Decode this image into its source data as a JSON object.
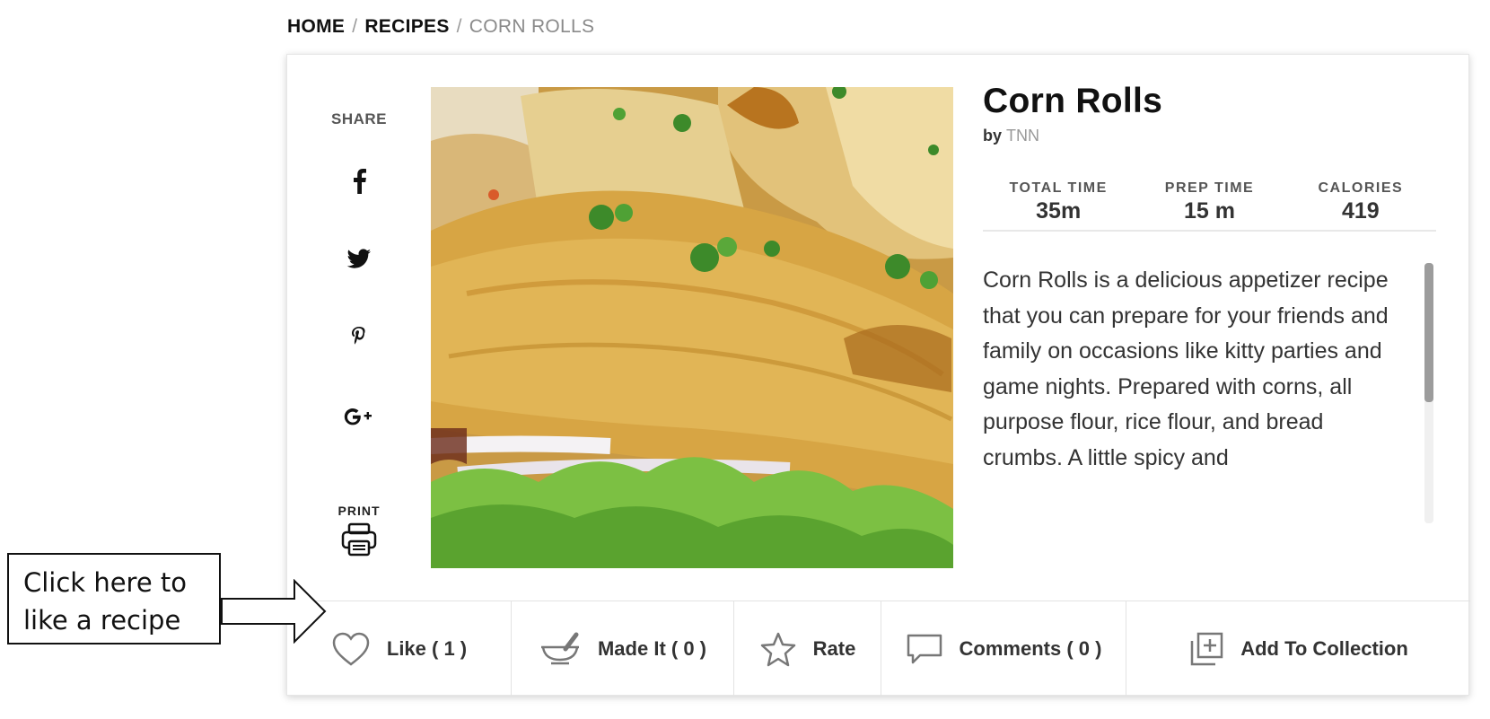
{
  "breadcrumb": {
    "home": "HOME",
    "sep": "/",
    "recipes": "RECIPES",
    "current": "CORN ROLLS"
  },
  "share": {
    "label": "SHARE",
    "icons": [
      "facebook-icon",
      "twitter-icon",
      "pinterest-icon",
      "google-plus-icon"
    ],
    "print_label": "PRINT",
    "print_icon": "printer-icon"
  },
  "recipe": {
    "title": "Corn Rolls",
    "by_label": "by",
    "author": "TNN",
    "stats": [
      {
        "label": "TOTAL TIME",
        "value": "35m"
      },
      {
        "label": "PREP TIME",
        "value": "15 m"
      },
      {
        "label": "CALORIES",
        "value": "419"
      }
    ],
    "description": "Corn Rolls is a delicious appetizer recipe that you can prepare for your friends and family on occasions like kitty parties and game nights. Prepared with corns, all purpose flour, rice flour, and bread crumbs. A little spicy and"
  },
  "actions": {
    "like": "Like ( 1 )",
    "made_it": "Made It ( 0 )",
    "rate": "Rate",
    "comments": "Comments ( 0 )",
    "add_to_collection": "Add To Collection"
  },
  "callout": {
    "line1": "Click here to",
    "line2": "like a recipe"
  },
  "colors": {
    "text_dark": "#111111",
    "muted": "#999999",
    "border": "#e3e3e3",
    "scrollbar_thumb": "#9c9c9c"
  }
}
